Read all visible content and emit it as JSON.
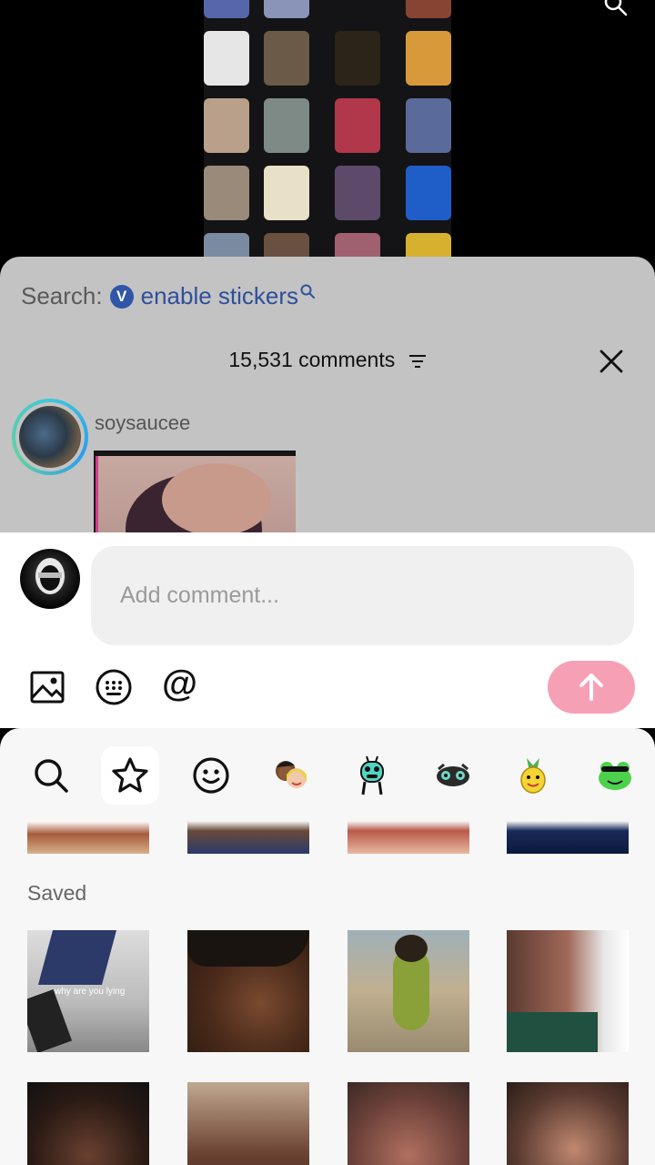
{
  "search": {
    "prefix": "Search:",
    "badge": "V",
    "keyword": "enable stickers"
  },
  "comments": {
    "count_label": "15,531 comments"
  },
  "comment": {
    "username": "soysaucee"
  },
  "input": {
    "placeholder": "Add comment..."
  },
  "toolbar": {
    "tools": [
      "image-icon",
      "keyboard-icon",
      "at-icon"
    ],
    "at_symbol": "@",
    "send_color": "#f6a0b6"
  },
  "sticker_panel": {
    "tabs": [
      "search-icon",
      "star-icon",
      "smiley-icon",
      "avatar-pair-icon",
      "alien-sticker-icon",
      "eyes-sticker-icon",
      "pineapple-sticker-icon",
      "frog-sticker-icon"
    ],
    "active_tab": "star-icon",
    "saved_label": "Saved",
    "saved_thumb_overlay": "why are you lying"
  },
  "colors": {
    "accent": "#2f56a8",
    "send": "#f6a0b6",
    "sheet_dim": "#c3c3c3"
  }
}
